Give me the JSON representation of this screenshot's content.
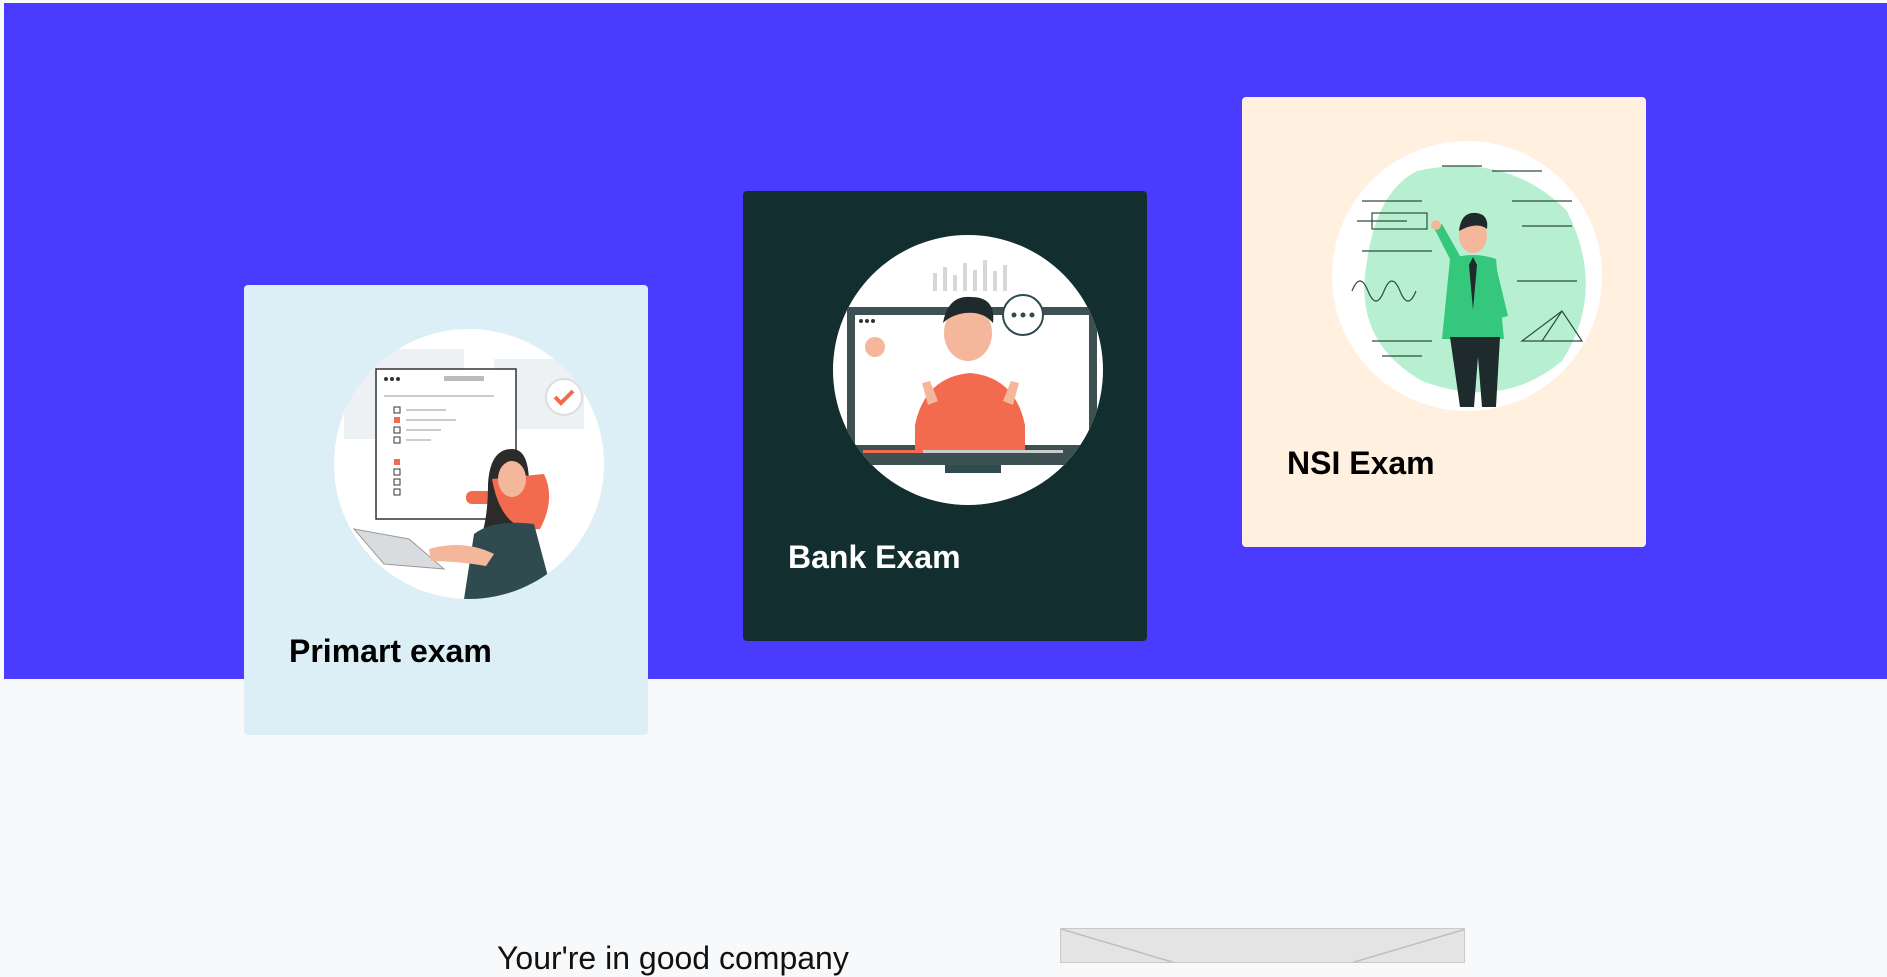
{
  "cards": [
    {
      "title": "Primart exam",
      "illustration": "online-test-illustration"
    },
    {
      "title": "Bank Exam",
      "illustration": "video-lecture-illustration"
    },
    {
      "title": "NSI Exam",
      "illustration": "teacher-formulas-illustration"
    }
  ],
  "company": {
    "heading": "Your're in good company"
  },
  "colors": {
    "hero": "#4b3bff",
    "card_primary": "#dceef6",
    "card_bank": "#132e2e",
    "card_nsi": "#fff0e0",
    "accent": "#f36b4f",
    "mint": "#b7f0d1"
  }
}
